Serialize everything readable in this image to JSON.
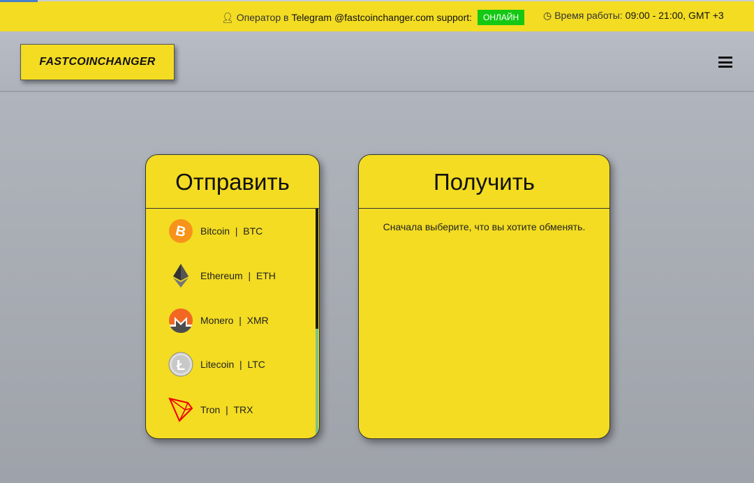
{
  "topbar": {
    "operator_prefix": "Оператор в",
    "telegram": "Telegram @fastcoinchanger.com support:",
    "status": "ОНЛАЙН",
    "hours_label": "Время работы:",
    "hours_value": "09:00 - 21:00, GMT +3",
    "status_color": "#14c814"
  },
  "header": {
    "logo": "FASTCOINCHANGER"
  },
  "send": {
    "title": "Отправить",
    "items": [
      {
        "name": "Bitcoin",
        "sep": "|",
        "code": "BTC"
      },
      {
        "name": "Ethereum",
        "sep": "|",
        "code": "ETH"
      },
      {
        "name": "Monero",
        "sep": "|",
        "code": "XMR"
      },
      {
        "name": "Litecoin",
        "sep": "|",
        "code": "LTC"
      },
      {
        "name": "Tron",
        "sep": "|",
        "code": "TRX"
      }
    ]
  },
  "receive": {
    "title": "Получить",
    "message": "Сначала выберите, что вы хотите обменять."
  },
  "colors": {
    "accent": "#f3dc22"
  }
}
